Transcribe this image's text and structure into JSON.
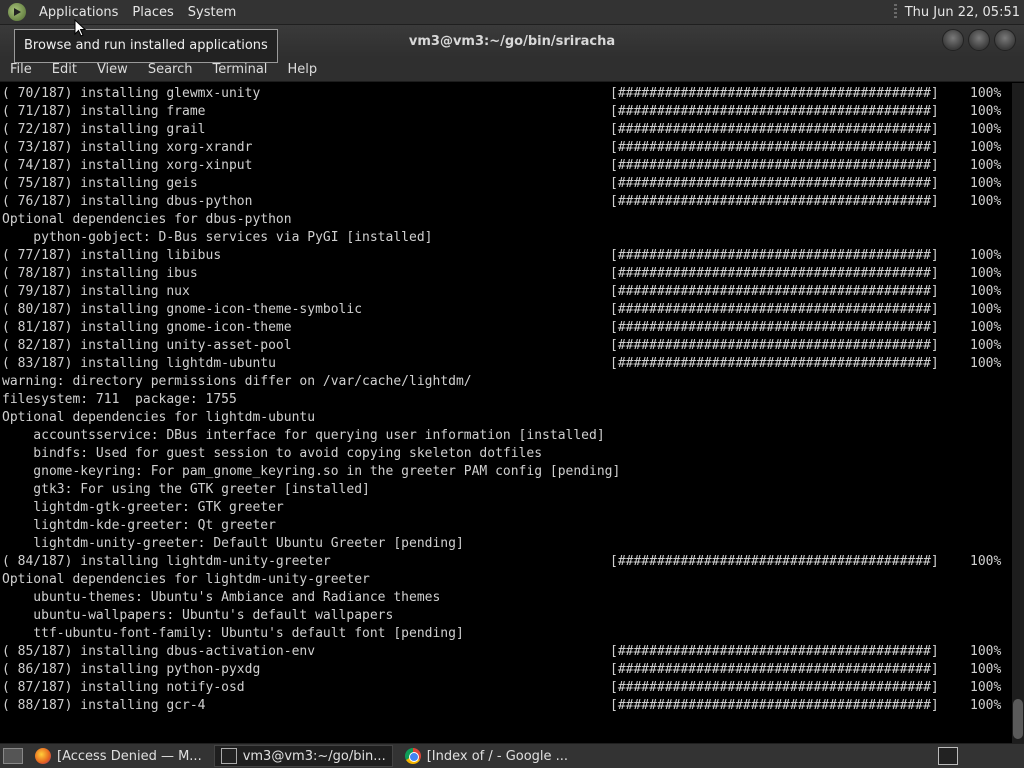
{
  "top_panel": {
    "menus": [
      "Applications",
      "Places",
      "System"
    ],
    "clock": "Thu Jun 22, 05:51"
  },
  "tooltip": "Browse and run installed applications",
  "window": {
    "title": "vm3@vm3:~/go/bin/sriracha",
    "menu": [
      "File",
      "Edit",
      "View",
      "Search",
      "Terminal",
      "Help"
    ]
  },
  "terminal": {
    "bar": "[########################################]",
    "lines": [
      {
        "text": "( 70/187) installing glewmx-unity",
        "pct": "100%"
      },
      {
        "text": "( 71/187) installing frame",
        "pct": "100%"
      },
      {
        "text": "( 72/187) installing grail",
        "pct": "100%"
      },
      {
        "text": "( 73/187) installing xorg-xrandr",
        "pct": "100%"
      },
      {
        "text": "( 74/187) installing xorg-xinput",
        "pct": "100%"
      },
      {
        "text": "( 75/187) installing geis",
        "pct": "100%"
      },
      {
        "text": "( 76/187) installing dbus-python",
        "pct": "100%"
      },
      {
        "text": "Optional dependencies for dbus-python"
      },
      {
        "text": "    python-gobject: D-Bus services via PyGI [installed]"
      },
      {
        "text": "( 77/187) installing libibus",
        "pct": "100%"
      },
      {
        "text": "( 78/187) installing ibus",
        "pct": "100%"
      },
      {
        "text": "( 79/187) installing nux",
        "pct": "100%"
      },
      {
        "text": "( 80/187) installing gnome-icon-theme-symbolic",
        "pct": "100%"
      },
      {
        "text": "( 81/187) installing gnome-icon-theme",
        "pct": "100%"
      },
      {
        "text": "( 82/187) installing unity-asset-pool",
        "pct": "100%"
      },
      {
        "text": "( 83/187) installing lightdm-ubuntu",
        "pct": "100%"
      },
      {
        "text": "warning: directory permissions differ on /var/cache/lightdm/"
      },
      {
        "text": "filesystem: 711  package: 1755"
      },
      {
        "text": "Optional dependencies for lightdm-ubuntu"
      },
      {
        "text": "    accountsservice: DBus interface for querying user information [installed]"
      },
      {
        "text": "    bindfs: Used for guest session to avoid copying skeleton dotfiles"
      },
      {
        "text": "    gnome-keyring: For pam_gnome_keyring.so in the greeter PAM config [pending]"
      },
      {
        "text": "    gtk3: For using the GTK greeter [installed]"
      },
      {
        "text": "    lightdm-gtk-greeter: GTK greeter"
      },
      {
        "text": "    lightdm-kde-greeter: Qt greeter"
      },
      {
        "text": "    lightdm-unity-greeter: Default Ubuntu Greeter [pending]"
      },
      {
        "text": "( 84/187) installing lightdm-unity-greeter",
        "pct": "100%"
      },
      {
        "text": "Optional dependencies for lightdm-unity-greeter"
      },
      {
        "text": "    ubuntu-themes: Ubuntu's Ambiance and Radiance themes"
      },
      {
        "text": "    ubuntu-wallpapers: Ubuntu's default wallpapers"
      },
      {
        "text": "    ttf-ubuntu-font-family: Ubuntu's default font [pending]"
      },
      {
        "text": "( 85/187) installing dbus-activation-env",
        "pct": "100%"
      },
      {
        "text": "( 86/187) installing python-pyxdg",
        "pct": "100%"
      },
      {
        "text": "( 87/187) installing notify-osd",
        "pct": "100%"
      },
      {
        "text": "( 88/187) installing gcr-4",
        "pct": "100%"
      }
    ]
  },
  "taskbar": {
    "tasks": [
      {
        "label": "[Access Denied — M...",
        "icon": "firefox-icon"
      },
      {
        "label": "vm3@vm3:~/go/bin...",
        "icon": "terminal-icon"
      },
      {
        "label": "[Index of / - Google ...",
        "icon": "chrome-icon"
      }
    ]
  }
}
